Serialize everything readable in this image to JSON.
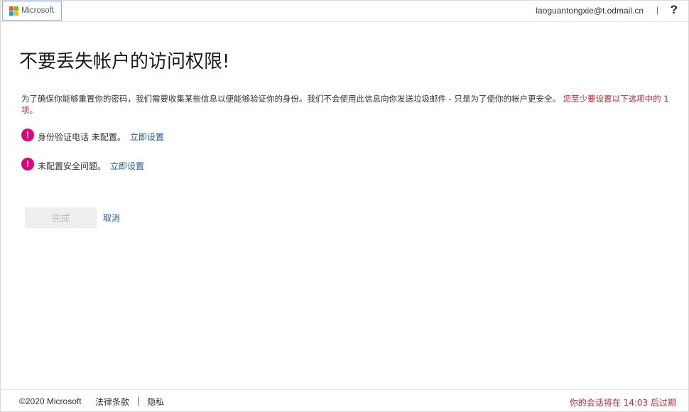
{
  "header": {
    "logo_text": "Microsoft",
    "account": "laoguantongxie@t.odmail.cn",
    "divider": "|",
    "help_label": "?"
  },
  "main": {
    "title": "不要丢失帐户的访问权限!",
    "intro": "为了确保你能够重置你的密码，我们需要收集某些信息以便能够验证你的身份。我们不会使用此信息向你发送垃圾邮件 - 只是为了使你的帐户更安全。",
    "intro_warning": "您至少要设置以下选项中的 1 项。",
    "items": [
      {
        "icon": "alert-icon",
        "text": "身份验证电话 未配置。",
        "link": "立即设置"
      },
      {
        "icon": "alert-icon",
        "text": "未配置安全问题。",
        "link": "立即设置"
      }
    ],
    "done_label": "完成",
    "cancel_label": "取消"
  },
  "footer": {
    "copyright": "©2020 Microsoft",
    "legal": "法律条款",
    "sep": "|",
    "privacy": "隐私",
    "session_prefix": "你的会话将在",
    "session_time": "14:03",
    "session_suffix": "后过期"
  },
  "colors": {
    "accent_link": "#1f5ea8",
    "warning_red": "#c4262e",
    "alert_icon": "#e3007a",
    "ms_red": "#f25022",
    "ms_green": "#7fba00",
    "ms_blue": "#00a4ef",
    "ms_yellow": "#ffb900"
  }
}
